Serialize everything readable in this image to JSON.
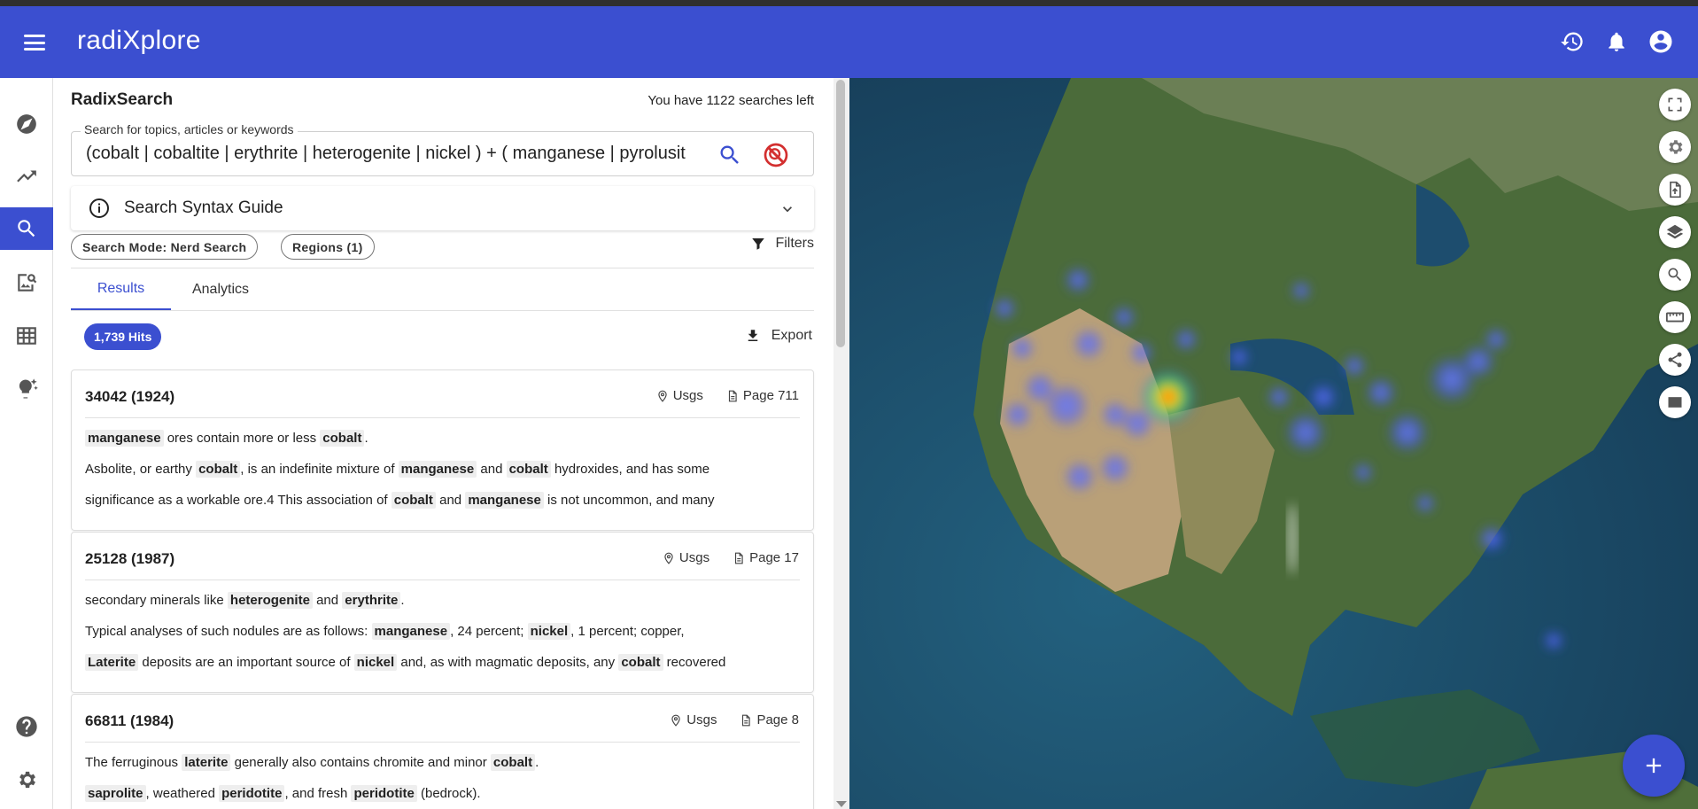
{
  "app": {
    "brand": "radiXplore"
  },
  "header_icons": [
    "menu-icon",
    "history-icon",
    "bell-icon",
    "account-circle-icon"
  ],
  "rail": {
    "items": [
      "explore-icon",
      "trending-icon",
      "search-icon",
      "image-search-icon",
      "table-icon",
      "ideas-icon"
    ],
    "bottom": [
      "help-icon",
      "settings-icon"
    ],
    "active": "search-icon"
  },
  "search": {
    "title": "RadixSearch",
    "searches_left": "You have 1122 searches left",
    "label": "Search for topics, articles or keywords",
    "query": "(cobalt | cobaltite | erythrite | heterogenite | nickel ) + ( manganese | pyrolusit"
  },
  "syntax_guide": {
    "label": "Search Syntax Guide"
  },
  "chips": {
    "mode": "Search Mode: Nerd Search",
    "regions": "Regions (1)"
  },
  "filters": {
    "label": "Filters"
  },
  "tabs": [
    {
      "label": "Results"
    },
    {
      "label": "Analytics"
    }
  ],
  "results": {
    "hits": "1,739 Hits",
    "export": "Export",
    "cards": [
      {
        "title": "34042 (1924)",
        "source": "Usgs",
        "page": "Page 711",
        "snippets": [
          [
            {
              "t": "manganese",
              "h": true
            },
            {
              "t": " ores contain more or less ",
              "h": false
            },
            {
              "t": "cobalt",
              "h": true
            },
            {
              "t": ".",
              "h": false
            }
          ],
          [
            {
              "t": "Asbolite, or earthy ",
              "h": false
            },
            {
              "t": "cobalt",
              "h": true
            },
            {
              "t": ", is an indefinite mixture of ",
              "h": false
            },
            {
              "t": "manganese",
              "h": true
            },
            {
              "t": " and ",
              "h": false
            },
            {
              "t": "cobalt",
              "h": true
            },
            {
              "t": " hydroxides, and has some",
              "h": false
            }
          ],
          [
            {
              "t": "significance as a workable ore.4 This association of ",
              "h": false
            },
            {
              "t": "cobalt",
              "h": true
            },
            {
              "t": " and ",
              "h": false
            },
            {
              "t": "manganese",
              "h": true
            },
            {
              "t": " is not uncommon, and many",
              "h": false
            }
          ]
        ]
      },
      {
        "title": "25128 (1987)",
        "source": "Usgs",
        "page": "Page 17",
        "snippets": [
          [
            {
              "t": "secondary minerals like ",
              "h": false
            },
            {
              "t": "heterogenite",
              "h": true
            },
            {
              "t": " and ",
              "h": false
            },
            {
              "t": "erythrite",
              "h": true
            },
            {
              "t": ".",
              "h": false
            }
          ],
          [
            {
              "t": "Typical analyses of such nodules are as follows: ",
              "h": false
            },
            {
              "t": "manganese",
              "h": true
            },
            {
              "t": ", 24 percent; ",
              "h": false
            },
            {
              "t": "nickel",
              "h": true
            },
            {
              "t": ", 1 percent; copper,",
              "h": false
            }
          ],
          [
            {
              "t": "Laterite",
              "h": true
            },
            {
              "t": " deposits are an important source of ",
              "h": false
            },
            {
              "t": "nickel",
              "h": true
            },
            {
              "t": " and, as with magmatic deposits, any ",
              "h": false
            },
            {
              "t": "cobalt",
              "h": true
            },
            {
              "t": " recovered",
              "h": false
            }
          ]
        ]
      },
      {
        "title": "66811 (1984)",
        "source": "Usgs",
        "page": "Page 8",
        "snippets": [
          [
            {
              "t": "The ferruginous ",
              "h": false
            },
            {
              "t": "laterite",
              "h": true
            },
            {
              "t": " generally also contains chromite and minor ",
              "h": false
            },
            {
              "t": "cobalt",
              "h": true
            },
            {
              "t": ".",
              "h": false
            }
          ],
          [
            {
              "t": "saprolite",
              "h": true
            },
            {
              "t": ", weathered ",
              "h": false
            },
            {
              "t": "peridotite",
              "h": true
            },
            {
              "t": ", and fresh ",
              "h": false
            },
            {
              "t": "peridotite",
              "h": true
            },
            {
              "t": " (bedrock).",
              "h": false
            }
          ]
        ]
      }
    ]
  },
  "map": {
    "tools": [
      "fullscreen-icon",
      "gear-icon",
      "file-upload-icon",
      "layers-icon",
      "zoom-search-icon",
      "ruler-icon",
      "share-icon",
      "rectangle-icon"
    ],
    "fab": "add-icon"
  },
  "colors": {
    "primary": "#3b4fd0",
    "appbar": "#3b4fd0",
    "ocean": "#1b4a68"
  }
}
